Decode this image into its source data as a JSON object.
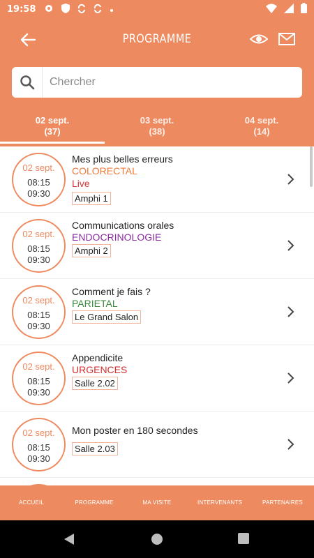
{
  "status": {
    "time": "19:58",
    "icons": [
      "settings-icon",
      "shield-icon",
      "sync-icon",
      "sync-icon",
      "dot-icon"
    ],
    "right_icons": [
      "wifi-icon",
      "signal-icon",
      "battery-icon"
    ]
  },
  "appbar": {
    "title": "PROGRAMME",
    "back_icon": "arrow-left-icon",
    "eye_icon": "eye-icon",
    "mail_icon": "mail-icon"
  },
  "search": {
    "placeholder": "Chercher",
    "value": ""
  },
  "tabs": [
    {
      "label": "02 sept.",
      "count": "(37)",
      "active": true
    },
    {
      "label": "03 sept.",
      "count": "(38)",
      "active": false
    },
    {
      "label": "04 sept.",
      "count": "(14)",
      "active": false
    }
  ],
  "items": [
    {
      "date": "02 sept.",
      "start": "08:15",
      "end": "09:30",
      "title": "Mes plus belles erreurs",
      "category": "COLORECTAL",
      "category_color": "#ee7a3a",
      "live": "Live",
      "room": "Amphi 1"
    },
    {
      "date": "02 sept.",
      "start": "08:15",
      "end": "09:30",
      "title": "Communications orales",
      "category": "ENDOCRINOLOGIE",
      "category_color": "#8a2ea0",
      "room": "Amphi 2"
    },
    {
      "date": "02 sept.",
      "start": "08:15",
      "end": "09:30",
      "title": "Comment je fais ?",
      "category": "PARIETAL",
      "category_color": "#3c8a3c",
      "room": "Le Grand Salon"
    },
    {
      "date": "02 sept.",
      "start": "08:15",
      "end": "09:30",
      "title": "Appendicite",
      "category": "URGENCES",
      "category_color": "#d32f2f",
      "room": "Salle 2.02"
    },
    {
      "date": "02 sept.",
      "start": "08:15",
      "end": "09:30",
      "title": "Mon poster en 180 secondes",
      "category": "",
      "category_color": "#333333",
      "room": "Salle 2.03"
    }
  ],
  "bottom_nav": [
    "ACCUEIL",
    "PROGRAMME",
    "MA VISITE",
    "INTERVENANTS",
    "PARTENAIRES"
  ],
  "colors": {
    "accent": "#ee8a5f"
  }
}
